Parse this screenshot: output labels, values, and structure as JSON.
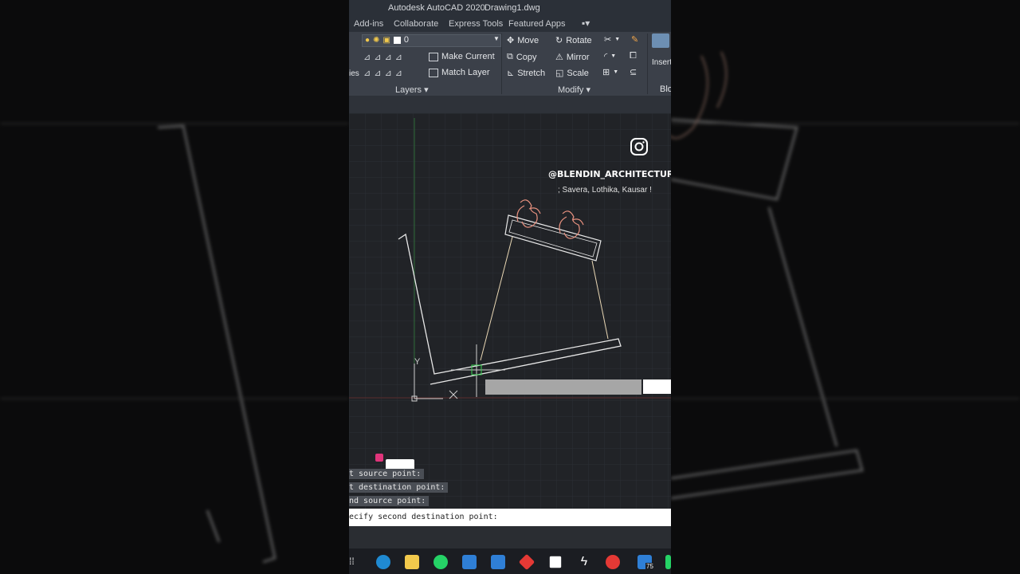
{
  "window": {
    "title": "Autodesk AutoCAD 2020",
    "filename": "Drawing1.dwg"
  },
  "menu": {
    "items": [
      "Add-ins",
      "Collaborate",
      "Express Tools",
      "Featured Apps"
    ]
  },
  "ribbon": {
    "layers": {
      "current_layer": "0",
      "make_current": "Make Current",
      "match_layer": "Match Layer",
      "partial_label": "ies",
      "panel_label": "Layers"
    },
    "modify": {
      "move": "Move",
      "rotate": "Rotate",
      "copy": "Copy",
      "mirror": "Mirror",
      "stretch": "Stretch",
      "scale": "Scale",
      "panel_label": "Modify"
    },
    "block": {
      "insert": "Insert",
      "panel_label": "Blo"
    }
  },
  "overlay": {
    "handle": "@BLENDIN_ARCHITECTURE",
    "credits": "; Savera, Lothika, Kausar !"
  },
  "ucs": {
    "y_label": "Y"
  },
  "command": {
    "history": [
      "t source point:",
      "t destination point:",
      "nd source point:"
    ],
    "current": "ecify second destination point:"
  },
  "taskbar": {
    "badge": "75"
  },
  "colors": {
    "ribbon_bg": "#3b4049",
    "canvas_bg": "#212327",
    "accent_pink": "#e0347a",
    "crosshair_green": "#39d353"
  }
}
